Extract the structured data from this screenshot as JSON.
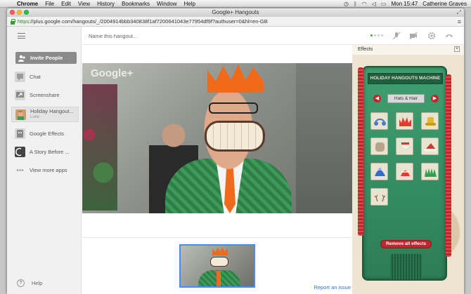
{
  "menubar": {
    "app": "Chrome",
    "items": [
      "File",
      "Edit",
      "View",
      "History",
      "Bookmarks",
      "Window",
      "Help"
    ],
    "clock": "Mon 15:47",
    "user": "Catherine Graves"
  },
  "window": {
    "title": "Google+ Hangouts",
    "url_scheme": "https",
    "url_rest": "://plus.google.com/hangouts/_/2004914bbb340838f1af7200641043e77954df9f?authuser=0&hl=en-GB"
  },
  "sidebar": {
    "invite_label": "Invite People",
    "items": [
      {
        "label": "Chat",
        "icon": "chat-icon"
      },
      {
        "label": "Screenshare",
        "icon": "screenshare-icon"
      },
      {
        "label": "Holiday Hangout...",
        "sublabel": "Luke",
        "icon": "holiday-app-icon"
      },
      {
        "label": "Google Effects",
        "icon": "effects-icon"
      },
      {
        "label": "A Story Before ...",
        "icon": "story-icon"
      },
      {
        "label": "View more apps",
        "icon": "more-apps-icon"
      }
    ],
    "help_label": "Help"
  },
  "topbar": {
    "name_placeholder": "Name this hangout..."
  },
  "video": {
    "watermark": "Google+"
  },
  "footer": {
    "report_label": "Report an issue"
  },
  "effects": {
    "header": "Effects",
    "machine_title": "HOLIDAY HANGOUTS MACHINE",
    "category": "Hats & Hair",
    "remove_label": "Remove all effects",
    "tiles": [
      "earmuffs",
      "crown",
      "gold-hat",
      "fur-hat",
      "santa-beard",
      "santa-hat",
      "blue-beanie",
      "pudding-hat",
      "green-tinsel",
      "reindeer-antlers"
    ]
  },
  "colors": {
    "accent_blue": "#4a8df0",
    "machine_green": "#3fa070",
    "tinsel_red": "#c0262e",
    "crown_orange": "#f06a1a"
  }
}
